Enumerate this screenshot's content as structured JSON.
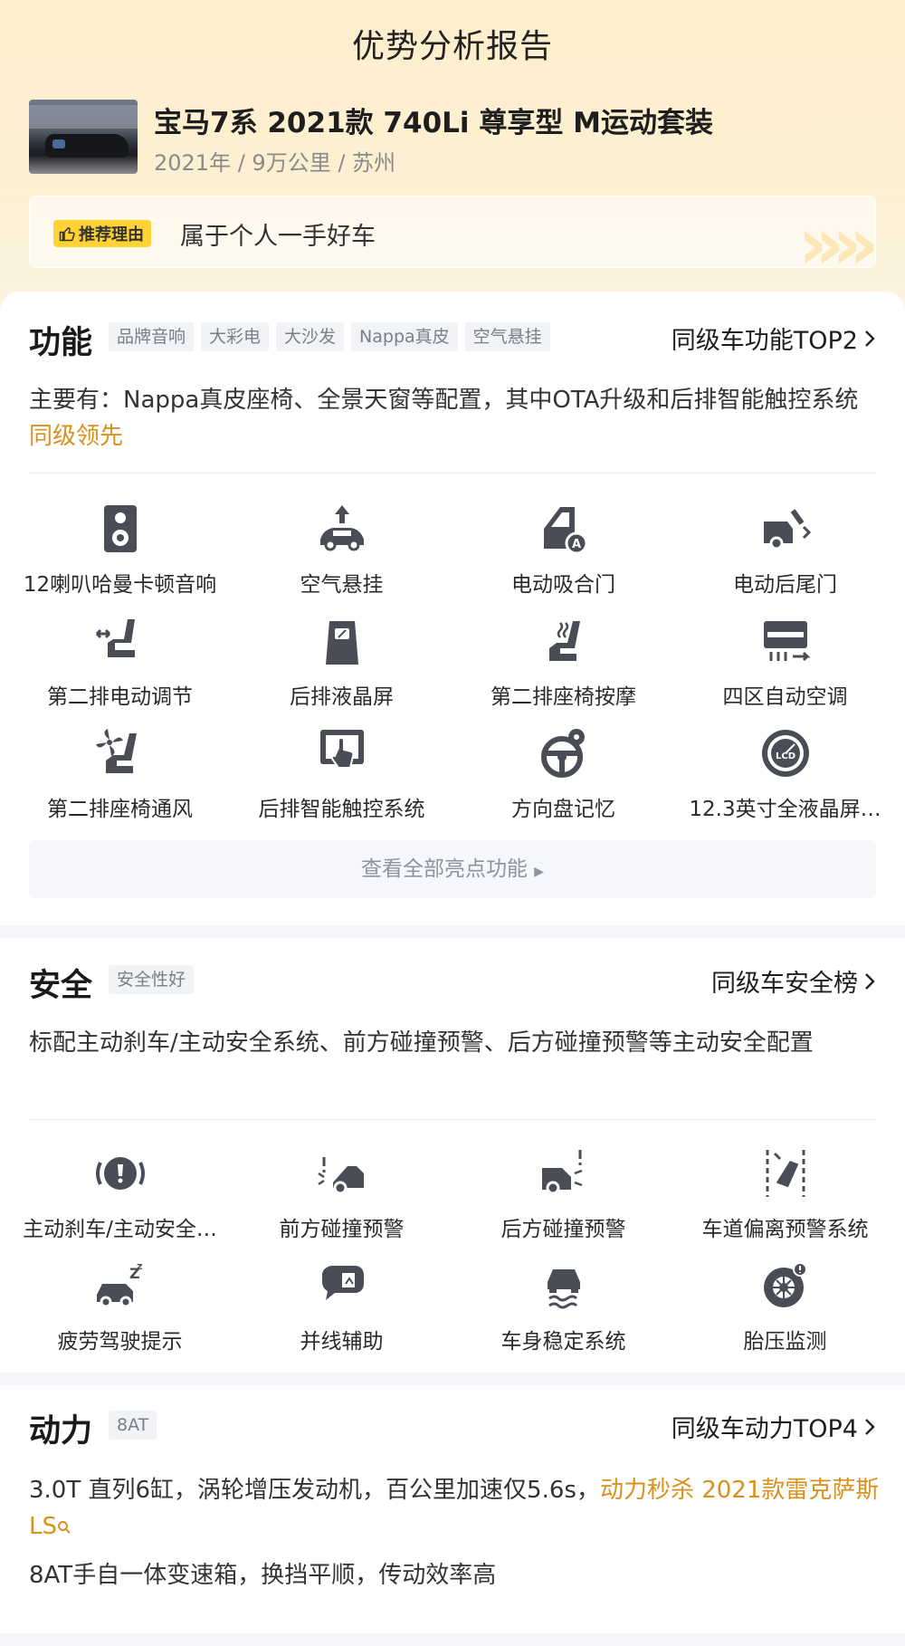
{
  "page": {
    "title": "优势分析报告"
  },
  "car": {
    "name": "宝马7系 2021款 740Li 尊享型 M运动套装",
    "meta": "2021年 / 9万公里 / 苏州",
    "reason_tag": "推荐理由",
    "reason_text": "属于个人一手好车"
  },
  "function": {
    "title": "功能",
    "tags": [
      "品牌音响",
      "大彩电",
      "大沙发",
      "Nappa真皮",
      "空气悬挂"
    ],
    "rank": "同级车功能TOP2",
    "desc_prefix": "主要有：Nappa真皮座椅、全景天窗等配置，其中OTA升级和后排智能触控系统",
    "desc_highlight": "同级领先",
    "features": [
      {
        "label": "12喇叭哈曼卡顿音响",
        "icon": "speaker-icon"
      },
      {
        "label": "空气悬挂",
        "icon": "air-suspension-icon"
      },
      {
        "label": "电动吸合门",
        "icon": "soft-close-door-icon"
      },
      {
        "label": "电动后尾门",
        "icon": "power-tailgate-icon"
      },
      {
        "label": "第二排电动调节",
        "icon": "seat-adjust-icon"
      },
      {
        "label": "后排液晶屏",
        "icon": "rear-screen-icon"
      },
      {
        "label": "第二排座椅按摩",
        "icon": "seat-massage-icon"
      },
      {
        "label": "四区自动空调",
        "icon": "climate-icon"
      },
      {
        "label": "第二排座椅通风",
        "icon": "seat-ventilation-icon"
      },
      {
        "label": "后排智能触控系统",
        "icon": "touch-control-icon"
      },
      {
        "label": "方向盘记忆",
        "icon": "steering-memory-icon"
      },
      {
        "label": "12.3英寸全液晶屏…",
        "icon": "lcd-gauge-icon"
      }
    ],
    "view_all": "查看全部亮点功能"
  },
  "safety": {
    "title": "安全",
    "tags": [
      "安全性好"
    ],
    "rank": "同级车安全榜",
    "desc": "标配主动刹车/主动安全系统、前方碰撞预警、后方碰撞预警等主动安全配置",
    "features": [
      {
        "label": "主动刹车/主动安全…",
        "icon": "brake-warning-icon"
      },
      {
        "label": "前方碰撞预警",
        "icon": "front-collision-icon"
      },
      {
        "label": "后方碰撞预警",
        "icon": "rear-collision-icon"
      },
      {
        "label": "车道偏离预警系统",
        "icon": "lane-departure-icon"
      },
      {
        "label": "疲劳驾驶提示",
        "icon": "fatigue-icon"
      },
      {
        "label": "并线辅助",
        "icon": "blind-spot-icon"
      },
      {
        "label": "车身稳定系统",
        "icon": "stability-icon"
      },
      {
        "label": "胎压监测",
        "icon": "tire-pressure-icon"
      }
    ]
  },
  "power": {
    "title": "动力",
    "tags": [
      "8AT"
    ],
    "rank": "同级车动力TOP4",
    "desc_prefix": "3.0T 直列6缸，涡轮增压发动机，百公里加速仅5.6s，",
    "desc_highlight": "动力秒杀 2021款雷克萨斯LS",
    "desc2": "8AT手自一体变速箱，换挡平顺，传动效率高"
  },
  "colors": {
    "accent": "#d8911c",
    "tag_yellow": "#fed333",
    "icon": "#4a4d55"
  }
}
